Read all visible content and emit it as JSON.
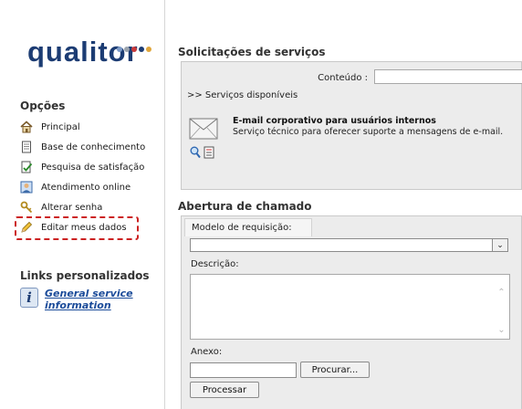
{
  "logo": {
    "text": "qualitor",
    "dot_colors": [
      "#7e9cc8",
      "#9aa3ad",
      "#c8393b",
      "#1c3c73",
      "#e0a63b"
    ]
  },
  "sidebar": {
    "options_title": "Opções",
    "items": [
      {
        "label": "Principal",
        "icon": "home-icon"
      },
      {
        "label": "Base de conhecimento",
        "icon": "document-icon"
      },
      {
        "label": "Pesquisa de satisfação",
        "icon": "survey-icon"
      },
      {
        "label": "Atendimento online",
        "icon": "support-agent-icon"
      },
      {
        "label": "Alterar senha",
        "icon": "key-icon"
      },
      {
        "label": "Editar meus dados",
        "icon": "pencil-icon"
      }
    ],
    "links_title": "Links personalizados",
    "custom_link": "General service information"
  },
  "services": {
    "title": "Solicitações de serviços",
    "search_label": "Conteúdo :",
    "search_value": "",
    "available_link": ">> Serviços disponíveis",
    "item": {
      "title": "E-mail corporativo para usuários internos",
      "description": "Serviço técnico para oferecer suporte a mensagens de e-mail."
    }
  },
  "ticket": {
    "title": "Abertura de chamado",
    "model_label": "Modelo de requisição:",
    "model_value": "",
    "description_label": "Descrição:",
    "attachment_label": "Anexo:",
    "browse_label": "Procurar...",
    "submit_label": "Processar"
  },
  "colors": {
    "brand": "#1c3c73",
    "highlight": "#cc2222",
    "panel_bg": "#ececec"
  }
}
